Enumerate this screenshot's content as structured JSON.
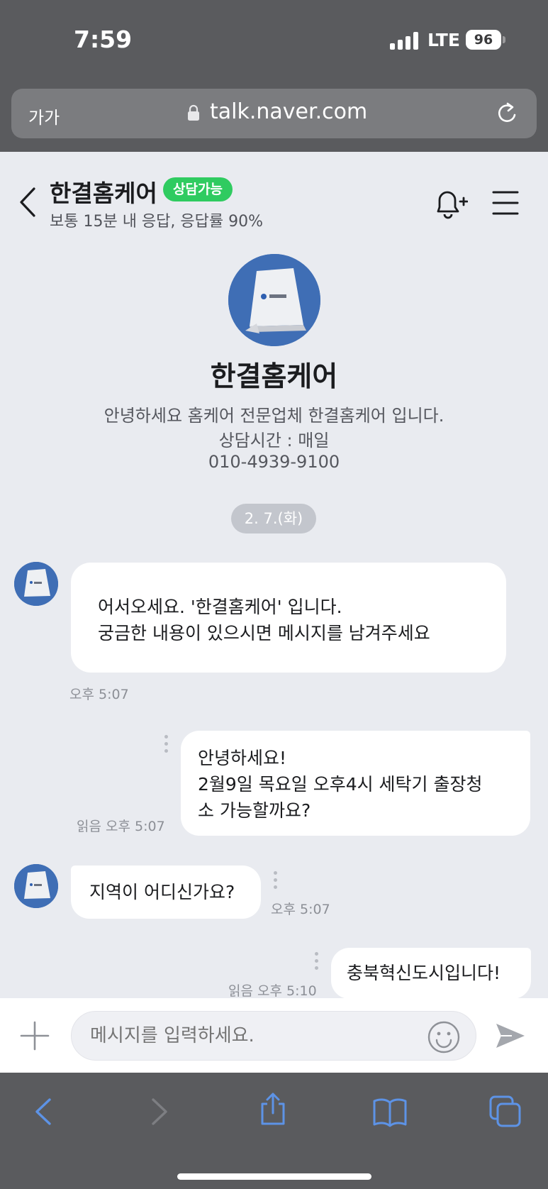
{
  "status_bar": {
    "time": "7:59",
    "network": "LTE",
    "battery": "96"
  },
  "browser": {
    "text_size_label": "가가",
    "url": "talk.naver.com"
  },
  "header": {
    "store_name": "한결홈케어",
    "status_badge": "상담가능",
    "response_info": "보통 15분 내 응답, 응답률 90%"
  },
  "profile": {
    "name": "한결홈케어",
    "intro_lines": [
      "안녕하세요 홈케어 전문업체 한결홈케어 입니다.",
      "상담시간 : 매일",
      "010-4939-9100"
    ]
  },
  "date_divider": "2. 7.(화)",
  "messages": [
    {
      "from": "store",
      "lines": [
        "어서오세요. '한결홈케어' 입니다.",
        "궁금한 내용이 있으시면 메시지를 남겨주세요"
      ],
      "time": "오후 5:07"
    },
    {
      "from": "me",
      "lines": [
        "안녕하세요!",
        "2월9일 목요일 오후4시 세탁기 출장청",
        "소 가능할까요?"
      ],
      "read": "읽음",
      "time": "오후 5:07"
    },
    {
      "from": "store",
      "lines": [
        "지역이 어디신가요?"
      ],
      "time": "오후 5:07"
    },
    {
      "from": "me",
      "lines": [
        "충북혁신도시입니다!"
      ],
      "read": "읽음",
      "time": "오후 5:10"
    }
  ],
  "composer": {
    "placeholder": "메시지를 입력하세요."
  },
  "colors": {
    "badge_green": "#2fcb60",
    "avatar_blue": "#3f6eb5",
    "chat_bg": "#e9ebf0",
    "toolbar_blue": "#5d93e6"
  },
  "icons": [
    "back-chevron-icon",
    "bell-plus-icon",
    "menu-icon",
    "plus-icon",
    "emoji-icon",
    "send-icon",
    "lock-icon",
    "reload-icon",
    "share-icon",
    "bookmarks-icon",
    "tabs-icon"
  ]
}
